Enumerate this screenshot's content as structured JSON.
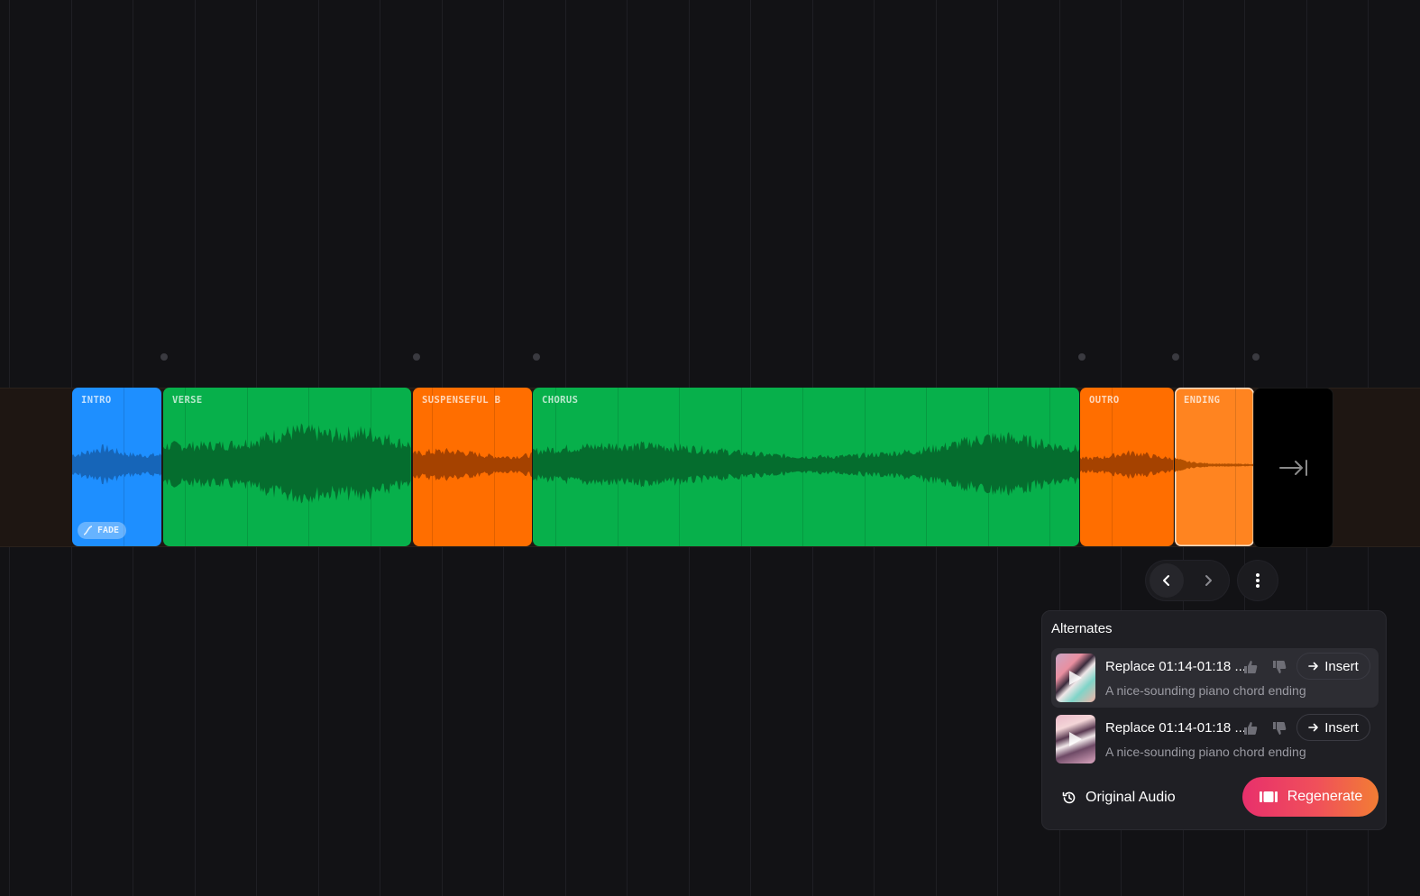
{
  "timeline": {
    "sections": [
      {
        "key": "intro",
        "label": "INTRO",
        "color": "#1e8fff",
        "waveColor": "#1665b8"
      },
      {
        "key": "verse",
        "label": "VERSE",
        "color": "#07b04b",
        "waveColor": "#056d2e"
      },
      {
        "key": "suspenseful",
        "label": "SUSPENSEFUL B",
        "color": "#ff6e00",
        "waveColor": "#a54200"
      },
      {
        "key": "chorus",
        "label": "CHORUS",
        "color": "#07b04b",
        "waveColor": "#056d2e"
      },
      {
        "key": "outro",
        "label": "OUTRO",
        "color": "#ff6e00",
        "waveColor": "#a54200"
      },
      {
        "key": "ending",
        "label": "ENDING",
        "color": "#ff8420",
        "waveColor": "#b35000",
        "selected": true
      }
    ],
    "fade_badge": "FADE",
    "end_icon": "skip-to-end-icon"
  },
  "controls": {
    "prev_icon": "chevron-left-icon",
    "next_icon": "chevron-right-icon",
    "more_icon": "more-vertical-icon"
  },
  "alternates": {
    "title": "Alternates",
    "items": [
      {
        "title": "Replace 01:14-01:18 ...",
        "description": "A nice-sounding piano chord ending",
        "insert_label": "Insert",
        "active": true
      },
      {
        "title": "Replace 01:14-01:18 ...",
        "description": "A nice-sounding piano chord ending",
        "insert_label": "Insert",
        "active": false
      }
    ],
    "original_audio_label": "Original Audio",
    "regenerate_label": "Regenerate",
    "accent": "#e8306c"
  }
}
